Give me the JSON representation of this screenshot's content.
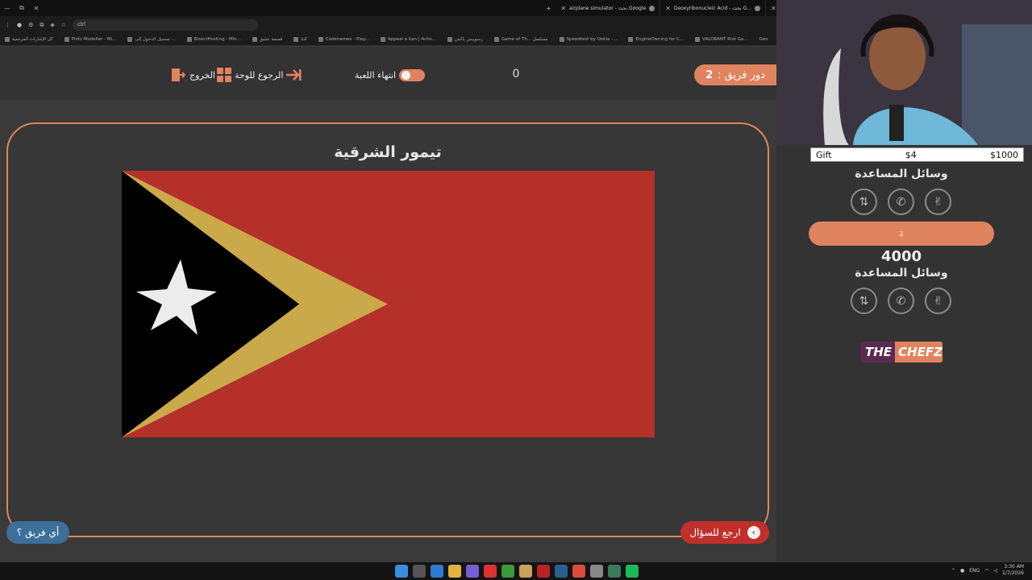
{
  "browser": {
    "tabs": [
      {
        "label": "airplane simulator - بحث Google"
      },
      {
        "label": "Deoxyribonucleic Acid - بحث G..."
      },
      {
        "label": "Go"
      }
    ],
    "address": "ctrl",
    "bookmarks": [
      "كل الإشارات المرجعية",
      "Plotz Modeller - Mi...",
      "تسجيل الدخول إلى ...",
      "BisectHosting - Min...",
      "قسمة عشق",
      "كنتا",
      "Codenames - Play...",
      "Appeal a ban | Activ...",
      "رسوبيس ياكش",
      "Game of Th... مسلسل",
      "Speedtest by Ookla -...",
      "EngineOwning for C...",
      "VALORANT Riot Ga...",
      "Geo"
    ]
  },
  "header": {
    "team_turn_label": "دور فريق :",
    "team_turn_value": "2",
    "center_score": "0",
    "end_game_label": "انتهاء اللعبة",
    "back_to_board_label": "الرجوع للوحة",
    "exit_label": "الخروج"
  },
  "question": {
    "country_name": "تيمور الشرقية"
  },
  "buttons": {
    "back_to_question": "ارجع للسؤال",
    "which_team": "أي فريق ؟"
  },
  "stream": {
    "gift_label": "Gift",
    "gift_amount": "$4",
    "gift_goal": "$1000"
  },
  "panel": {
    "team1_aids_label": "وسائل المساعدة",
    "team2_name": "2",
    "team2_score": "4000",
    "team2_aids_label": "وسائل المساعدة",
    "logo_part1": "THE",
    "logo_part2": "CHEFZ"
  },
  "taskbar": {
    "lang": "ENG",
    "time": "3:30 AM",
    "date": "1/7/2026"
  },
  "colors": {
    "accent": "#e0835f",
    "danger": "#c0302b",
    "blue": "#3c6f9a",
    "flag_red": "#b53029",
    "flag_yellow": "#c9a94a",
    "flag_black": "#000000"
  }
}
